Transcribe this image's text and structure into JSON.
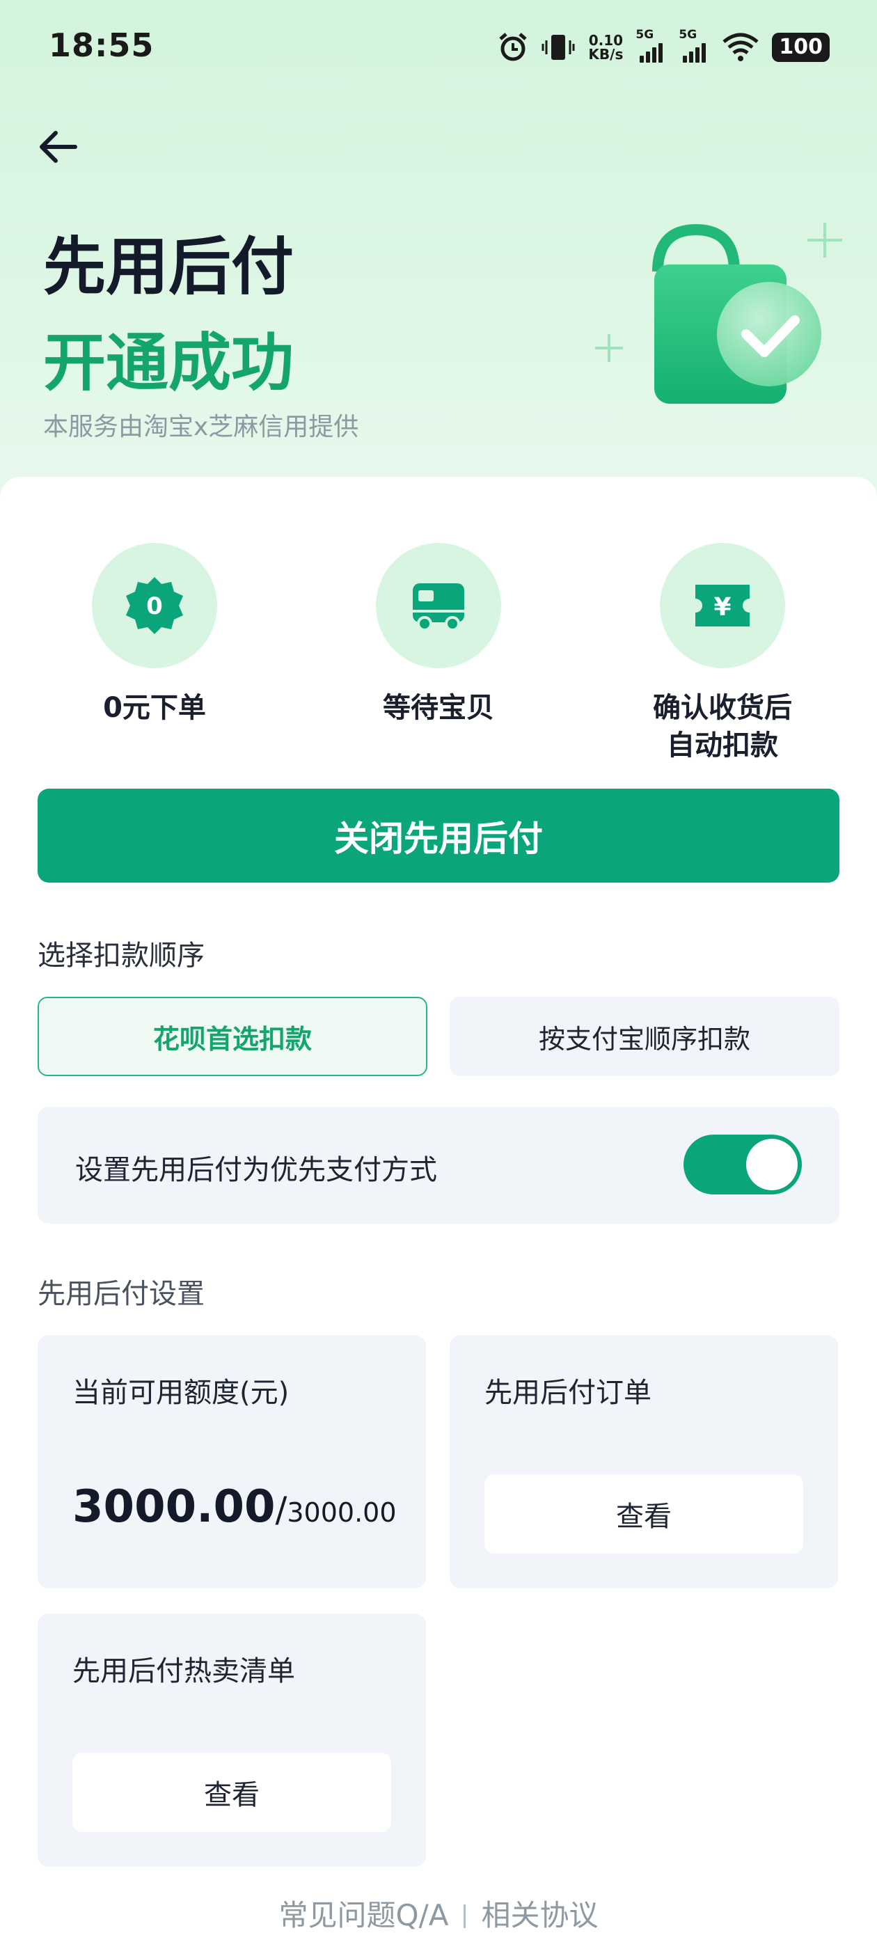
{
  "status_bar": {
    "time": "18:55",
    "net_speed_value": "0.10",
    "net_speed_unit": "KB/s",
    "sim1_label": "5G",
    "sim2_label": "5G",
    "battery": "100"
  },
  "hero": {
    "title_line1": "先用后付",
    "title_line2": "开通成功",
    "provider": "本服务由淘宝x芝麻信用提供"
  },
  "features": [
    {
      "icon": "zero-badge-icon",
      "badge_text": "0",
      "label": "0元下单"
    },
    {
      "icon": "truck-icon",
      "label": "等待宝贝"
    },
    {
      "icon": "yuan-ticket-icon",
      "badge_text": "¥",
      "label": "确认收货后\n自动扣款"
    }
  ],
  "close_button": "关闭先用后付",
  "deduction_order": {
    "label": "选择扣款顺序",
    "options": [
      {
        "label": "花呗首选扣款",
        "selected": true
      },
      {
        "label": "按支付宝顺序扣款",
        "selected": false
      }
    ]
  },
  "preferred_payment": {
    "label": "设置先用后付为优先支付方式",
    "enabled": true
  },
  "settings": {
    "label": "先用后付设置",
    "credit_tile": {
      "title": "当前可用额度(元)",
      "available": "3000.00",
      "separator": "/",
      "total": "3000.00"
    },
    "orders_tile": {
      "title": "先用后付订单",
      "button": "查看"
    },
    "hot_list_tile": {
      "title": "先用后付热卖清单",
      "button": "查看"
    }
  },
  "footer": {
    "faq": "常见问题Q/A",
    "agreements": "相关协议"
  },
  "colors": {
    "accent": "#0aa57b",
    "success_text": "#13a56c",
    "hero_bg": "#d3f3dc",
    "tile_bg": "#f1f4f8"
  }
}
